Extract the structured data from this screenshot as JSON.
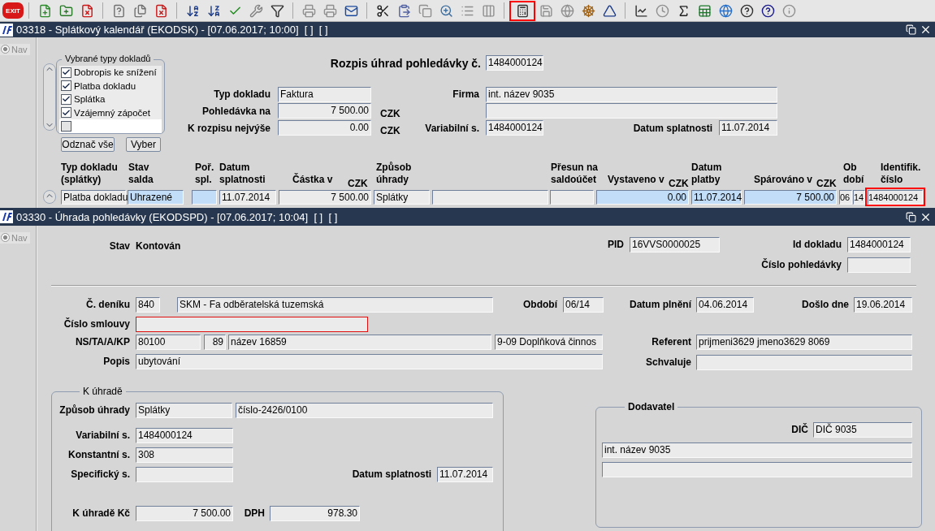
{
  "toolbar": {
    "exit_label": "EXIT",
    "buttons": [
      {
        "marked": false
      },
      {
        "marked": false
      },
      {
        "marked": false
      },
      {
        "marked": false
      },
      {
        "marked": false
      },
      {
        "marked": false
      },
      {
        "marked": false
      },
      {
        "marked": false
      },
      {
        "marked": false
      },
      {
        "marked": false
      },
      {
        "marked": false
      },
      {
        "marked": false
      },
      {
        "marked": false
      },
      {
        "marked": false
      },
      {
        "marked": false
      },
      {
        "marked": false
      },
      {
        "marked": false
      },
      {
        "marked": false
      },
      {
        "marked": false
      },
      {
        "marked": false
      },
      {
        "marked": true
      },
      {
        "marked": false
      },
      {
        "marked": false
      },
      {
        "marked": false
      },
      {
        "marked": false
      },
      {
        "marked": false
      },
      {
        "marked": false
      },
      {
        "marked": false
      },
      {
        "marked": false
      },
      {
        "marked": false
      },
      {
        "marked": false
      },
      {
        "marked": false
      },
      {
        "marked": false
      }
    ]
  },
  "window1": {
    "title": "03318 - Splátkový kalendář (EKODSK) - [07.06.2017; 10:00]  [ ]  [ ]",
    "nav": {
      "label": "Nav",
      "selected": true
    },
    "doc_types": {
      "legend": "Vybrané typy dokladů",
      "items": [
        {
          "label": "Dobropis ke snížení",
          "checked": true
        },
        {
          "label": "Platba dokladu",
          "checked": true
        },
        {
          "label": "Splátka",
          "checked": true
        },
        {
          "label": "Vzájemný zápočet",
          "checked": true
        },
        {
          "checked": false
        }
      ],
      "buttons": [
        "Odznač vše",
        "Vyber"
      ]
    },
    "heading": {
      "label": "Rozpis úhrad pohledávky č.",
      "value": "1484000124"
    },
    "entries": [
      {
        "label": "Typ dokladu",
        "fields": [
          {
            "value": "Faktura",
            "required": false
          }
        ]
      },
      {
        "label": "Pohledávka na",
        "fields": [
          {
            "value": "7 500.00",
            "required": false
          }
        ],
        "unit": "CZK"
      },
      {
        "label": "K rozpisu nejvýše",
        "fields": [
          {
            "value": "0.00",
            "required": false
          }
        ],
        "unit": "CZK"
      },
      {
        "label": "Firma",
        "fields": [
          {
            "value": "int. název 9035",
            "required": false
          }
        ]
      },
      {
        "fields": [
          {
            "required": false
          }
        ]
      },
      {
        "label": "Variabilní s.",
        "fields": [
          {
            "value": "1484000124",
            "required": false
          }
        ]
      },
      {
        "label": "Datum splatnosti",
        "fields": [
          {
            "value": "11.07.2014",
            "required": false
          }
        ]
      }
    ],
    "table": {
      "columns": [
        {
          "header": "Typ dokladu\n(splátky)"
        },
        {
          "header": "Stav\nsalda"
        },
        {
          "header": "Poř.\nspl."
        },
        {
          "header": "Datum\nsplatnosti"
        },
        {
          "header": "Částka v",
          "currency": "CZK"
        },
        {
          "header": "Způsob\núhrady"
        },
        {},
        {
          "header": "Přesun na\nsaldoúčet"
        },
        {
          "header": "Vystaveno v",
          "currency": "CZK"
        },
        {
          "header": "Datum\nplatby"
        },
        {
          "header": "Spárováno v",
          "currency": "CZK"
        },
        {
          "header": "Ob\ndobí"
        },
        {},
        {
          "header": "Identifik.\nčíslo"
        }
      ],
      "rows": [
        {
          "cells": [
            {
              "value": "Platba dokladu",
              "highlighted": false,
              "marked": false
            },
            {
              "value": "Uhrazené",
              "highlighted": true,
              "marked": false
            },
            {
              "highlighted": true,
              "marked": false
            },
            {
              "value": "11.07.2014",
              "highlighted": false,
              "marked": false
            },
            {
              "value": "7 500.00",
              "highlighted": false,
              "marked": false
            },
            {
              "value": "Splátky",
              "highlighted": false,
              "marked": false
            },
            {
              "highlighted": false,
              "marked": false
            },
            {
              "highlighted": false,
              "marked": false
            },
            {
              "value": "0.00",
              "highlighted": true,
              "marked": false
            },
            {
              "value": "11.07.2014",
              "highlighted": true,
              "marked": false
            },
            {
              "value": "7 500.00",
              "highlighted": true,
              "marked": false
            },
            {
              "value": "06",
              "highlighted": false,
              "marked": false
            },
            {
              "value": "14",
              "highlighted": false,
              "marked": false
            },
            {
              "value": "1484000124",
              "highlighted": false,
              "marked": true
            }
          ]
        }
      ]
    }
  },
  "window2": {
    "title": "03330 - Úhrada pohledávky (EKODSPD) - [07.06.2017; 10:04]  [ ]  [ ]",
    "nav": {
      "label": "Nav",
      "selected": true
    },
    "status": {
      "label": "Stav",
      "value": "Kontován"
    },
    "entries": [
      {
        "label": "PID",
        "fields": [
          {
            "value": "16VVS0000025",
            "required": false
          }
        ]
      },
      {
        "label": "Id dokladu",
        "fields": [
          {
            "value": "1484000124",
            "required": false
          }
        ]
      },
      {
        "label": "Číslo pohledávky",
        "fields": [
          {
            "required": false
          }
        ]
      },
      {
        "label": "Č. deníku",
        "fields": [
          {
            "value": "840",
            "required": false
          },
          {
            "value": "SKM - Fa odběratelská tuzemská",
            "required": false
          }
        ]
      },
      {
        "label": "Období",
        "fields": [
          {
            "value": "06/14",
            "required": false
          }
        ]
      },
      {
        "label": "Datum plnění",
        "fields": [
          {
            "value": "04.06.2014",
            "required": false
          }
        ]
      },
      {
        "label": "Došlo dne",
        "fields": [
          {
            "value": "19.06.2014",
            "required": false
          }
        ]
      },
      {
        "label": "Číslo smlouvy",
        "fields": [
          {
            "required": true
          }
        ]
      },
      {
        "label": "NS/TA/A/KP",
        "fields": [
          {
            "value": "80100",
            "required": false
          },
          {
            "value": "89",
            "required": false
          },
          {
            "value": "název 16859",
            "required": false
          },
          {
            "value": "9-09 Doplňková činnos",
            "required": false
          }
        ]
      },
      {
        "label": "Referent",
        "fields": [
          {
            "value": "prijmeni3629 jmeno3629 8069",
            "required": false
          }
        ]
      },
      {
        "label": "Popis",
        "fields": [
          {
            "value": "ubytování",
            "required": false
          }
        ]
      },
      {
        "label": "Schvaluje",
        "fields": [
          {
            "required": false
          }
        ]
      }
    ],
    "payment_group": {
      "legend": "K úhradě",
      "entries": [
        {
          "label": "Způsob úhrady",
          "fields": [
            {
              "value": "Splátky",
              "required": false
            },
            {
              "value": "číslo-2426/0100",
              "required": false
            }
          ]
        },
        {
          "label": "Variabilní s.",
          "fields": [
            {
              "value": "1484000124",
              "required": false
            }
          ]
        },
        {
          "label": "Konstantní s.",
          "fields": [
            {
              "value": "308",
              "required": false
            }
          ]
        },
        {
          "label": "Specifický s.",
          "fields": [
            {
              "required": false
            }
          ]
        },
        {
          "label": "Datum splatnosti",
          "fields": [
            {
              "value": "11.07.2014",
              "required": false
            }
          ]
        },
        {
          "label": "K úhradě Kč",
          "fields": [
            {
              "value": "7 500.00",
              "required": false
            }
          ]
        },
        {
          "label": "DPH",
          "fields": [
            {
              "value": "978.30",
              "required": false
            }
          ]
        }
      ]
    },
    "supplier_group": {
      "legend": "Dodavatel",
      "entries": [
        {
          "label": "DIČ",
          "fields": [
            {
              "value": "DIČ 9035",
              "required": false
            }
          ]
        },
        {
          "fields": [
            {
              "value": "int. název 9035",
              "required": false
            }
          ]
        },
        {
          "fields": [
            {
              "required": false
            }
          ]
        }
      ]
    }
  }
}
